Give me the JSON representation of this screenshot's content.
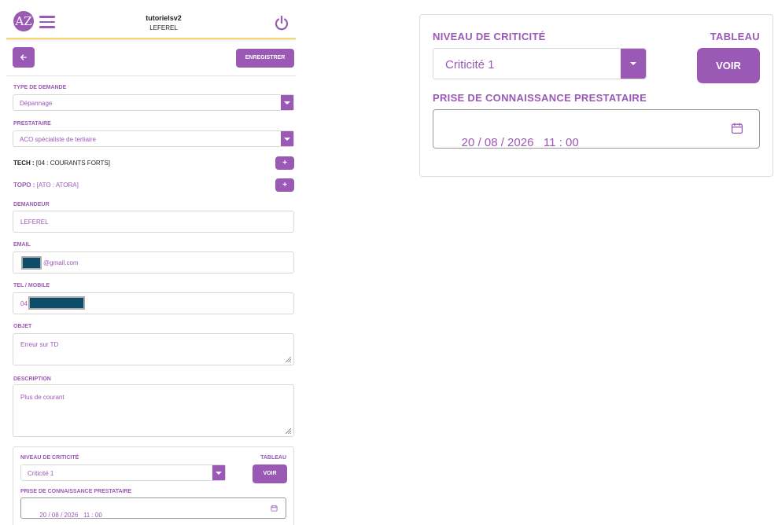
{
  "header": {
    "logo_text": "AZ",
    "title": "tutorielsv2",
    "subtitle": "LEFEREL",
    "menu_icon": "hamburger-icon",
    "power_icon": "power-icon"
  },
  "toolbar": {
    "back_icon": "arrow-left-icon",
    "save_label": "ENREGISTRER"
  },
  "form": {
    "type_demande": {
      "label": "TYPE DE DEMANDE",
      "value": "Dépannage"
    },
    "prestataire": {
      "label": "PRESTATAIRE",
      "value": "ACO spécialiste de tertiaire"
    },
    "tech": {
      "label": "TECH :",
      "value": "[04 : COURANTS FORTS]",
      "add_label": "+"
    },
    "topo": {
      "label": "TOPO :",
      "value": "[ATO : ATORA]",
      "add_label": "+"
    },
    "demandeur": {
      "label": "DEMANDEUR",
      "value": "LEFEREL"
    },
    "email": {
      "label": "EMAIL",
      "value": "@gmail.com"
    },
    "tel": {
      "label": "TEL / MOBILE",
      "value": "04"
    },
    "objet": {
      "label": "OBJET",
      "value": "Erreur sur TD"
    },
    "description": {
      "label": "DESCRIPTION",
      "value": "Plus de courant"
    }
  },
  "criticite": {
    "label": "NIVEAU DE CRITICITÉ",
    "value": "Criticité 1",
    "tableau_label": "TABLEAU",
    "voir_label": "VOIR",
    "prise_label": "PRISE DE CONNAISSANCE PRESTATAIRE",
    "prise_value": "20 / 08 / 2026   11 : 00",
    "calendar_icon": "calendar-icon"
  },
  "colors": {
    "accent": "#9b59b6",
    "header_border": "#f5d76e",
    "redaction": "#0d4d6a"
  }
}
